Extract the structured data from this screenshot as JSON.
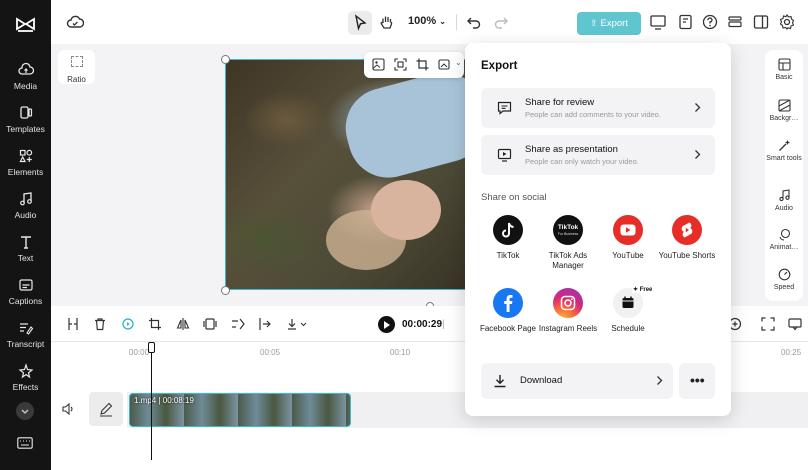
{
  "sidebar": {
    "logo_icon": "capcut-logo-icon",
    "items": [
      {
        "label": "Media",
        "icon": "cloud-upload-icon"
      },
      {
        "label": "Templates",
        "icon": "templates-icon"
      },
      {
        "label": "Elements",
        "icon": "elements-icon"
      },
      {
        "label": "Audio",
        "icon": "music-note-icon"
      },
      {
        "label": "Text",
        "icon": "text-icon"
      },
      {
        "label": "Captions",
        "icon": "captions-icon"
      },
      {
        "label": "Transcript",
        "icon": "transcript-icon"
      },
      {
        "label": "Effects",
        "icon": "effects-icon"
      }
    ]
  },
  "topbar": {
    "zoom": "100%",
    "export_label": "Export"
  },
  "canvas": {
    "ratio_label": "Ratio"
  },
  "right_panel": {
    "items": [
      {
        "label": "Basic",
        "icon": "basic-icon"
      },
      {
        "label": "Backgr…",
        "icon": "background-icon"
      },
      {
        "label": "Smart tools",
        "icon": "smart-tools-icon"
      },
      {
        "label": "Audio",
        "icon": "audio-icon"
      },
      {
        "label": "Animat…",
        "icon": "animation-icon"
      },
      {
        "label": "Speed",
        "icon": "speed-icon"
      }
    ]
  },
  "timeline": {
    "current_time": "00:00:29",
    "ruler": [
      "00:00",
      "00:05",
      "00:10",
      "00:25"
    ],
    "clip_name": "1.mp4",
    "clip_duration": "00:08:19"
  },
  "export_panel": {
    "title": "Export",
    "share_review": {
      "title": "Share for review",
      "subtitle": "People can add comments to your video."
    },
    "share_presentation": {
      "title": "Share as presentation",
      "subtitle": "People can only watch your video."
    },
    "social_heading": "Share on social",
    "social": [
      {
        "label": "TikTok",
        "icon": "tiktok-icon",
        "color": "#111111"
      },
      {
        "label": "TikTok Ads Manager",
        "icon": "tiktok-ads-icon",
        "color": "#111111"
      },
      {
        "label": "YouTube",
        "icon": "youtube-icon",
        "color": "#e62d27"
      },
      {
        "label": "YouTube Shorts",
        "icon": "youtube-shorts-icon",
        "color": "#e62d27"
      },
      {
        "label": "Facebook Page",
        "icon": "facebook-icon",
        "color": "#1877f2"
      },
      {
        "label": "Instagram Reels",
        "icon": "instagram-icon",
        "color": "#d6297b"
      },
      {
        "label": "Schedule",
        "icon": "calendar-icon",
        "color": "#f1f1f1"
      }
    ],
    "tiktok_ads_logo_text": "TikTok",
    "tiktok_ads_logo_sub": "For Business",
    "free_badge": "Free",
    "download_label": "Download",
    "more_label": "•••"
  },
  "colors": {
    "accent": "#5fc6cf",
    "selection": "#3fb9c7",
    "sidebar_bg": "#141414"
  }
}
